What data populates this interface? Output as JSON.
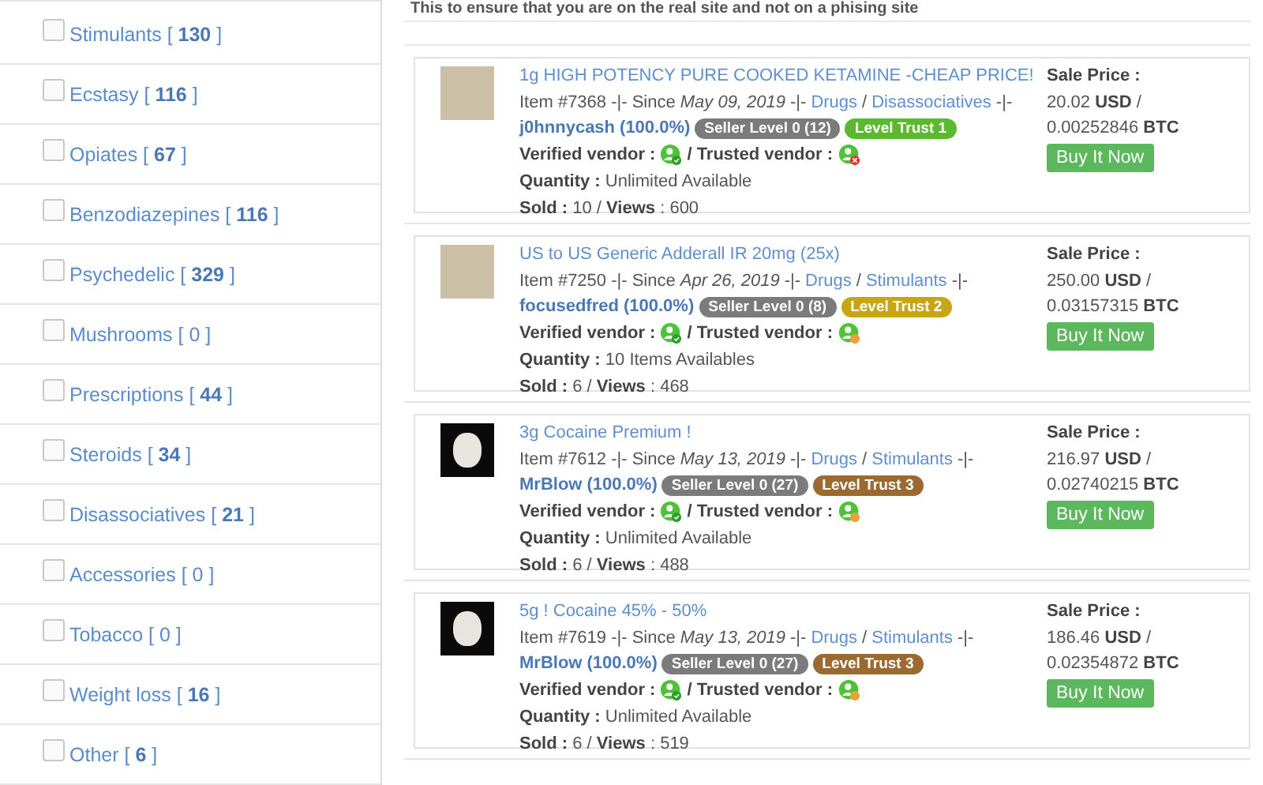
{
  "sidebar": {
    "categories": [
      {
        "label": "Stimulants [ **130** ]",
        "checked": false
      },
      {
        "label": "Ecstasy [ **116** ]",
        "checked": false
      },
      {
        "label": "Opiates [ **67** ]",
        "checked": false
      },
      {
        "label": "Benzodiazepines [ **116** ]",
        "checked": false
      },
      {
        "label": "Psychedelic [ **329** ]",
        "checked": false
      },
      {
        "label": "Mushrooms [ 0 ]",
        "checked": false
      },
      {
        "label": "Prescriptions [ **44** ]",
        "checked": false
      },
      {
        "label": "Steroids [ **34** ]",
        "checked": false
      },
      {
        "label": "Disassociatives [ **21** ]",
        "checked": false
      },
      {
        "label": "Accessories [ 0 ]",
        "checked": false
      },
      {
        "label": "Tobacco [ 0 ]",
        "checked": false
      },
      {
        "label": "Weight loss [ **16** ]",
        "checked": false
      },
      {
        "label": "Other [ **6** ]",
        "checked": false
      }
    ]
  },
  "notice": "This to ensure that you are on the real site and not on a phising site",
  "listings": [
    {
      "thumb": {
        "kind": "light"
      },
      "title": "1g HIGH POTENCY PURE COOKED KETAMINE -CHEAP PRICE!",
      "meta": [
        {
          "kind": "text",
          "text": "Item #7368 -|- Since"
        },
        {
          "kind": "date",
          "text": "May 09, 2019"
        },
        {
          "kind": "text",
          "text": "-|-"
        },
        {
          "kind": "link",
          "text": "Drugs"
        },
        {
          "kind": "text",
          "text": "/"
        },
        {
          "kind": "link",
          "text": "Disassociatives"
        },
        {
          "kind": "text",
          "text": "-|-"
        },
        {
          "kind": "seller",
          "text": "j0hnnycash"
        },
        {
          "kind": "seller",
          "text": "(100.0%)"
        },
        {
          "kind": "badge",
          "text": "Seller Level 0 (12)",
          "color": "#7b7b7b"
        },
        {
          "kind": "badge",
          "text": "Level Trust 1",
          "color": "#5cb82e"
        }
      ],
      "verified_label": "Verified vendor :",
      "verified": true,
      "trusted_label": "/ Trusted vendor :",
      "trusted": false,
      "quantity": "**Quantity :** Unlimited Available",
      "sold": "**Sold :** 10 / **Views** : 600",
      "price_label": "Sale Price :",
      "usd": "20.02 **USD** /",
      "btc": "0.00252846 **BTC**",
      "button": "Buy It Now"
    },
    {
      "thumb": {
        "kind": "light"
      },
      "title": "US to US Generic Adderall IR 20mg (25x)",
      "meta": [
        {
          "kind": "text",
          "text": "Item #7250 -|- Since"
        },
        {
          "kind": "date",
          "text": "Apr 26, 2019"
        },
        {
          "kind": "text",
          "text": "-|-"
        },
        {
          "kind": "link",
          "text": "Drugs"
        },
        {
          "kind": "text",
          "text": "/"
        },
        {
          "kind": "link",
          "text": "Stimulants"
        },
        {
          "kind": "text",
          "text": "-|-"
        },
        {
          "kind": "seller",
          "text": "focusedfred"
        },
        {
          "kind": "seller",
          "text": "(100.0%)"
        },
        {
          "kind": "badge",
          "text": "Seller Level 0 (8)",
          "color": "#7b7b7b"
        },
        {
          "kind": "badge",
          "text": "Level Trust 2",
          "color": "#c8a513"
        }
      ],
      "verified_label": "Verified vendor :",
      "verified": true,
      "trusted_label": "/ Trusted vendor :",
      "trusted": true,
      "quantity": "**Quantity :** 10 Items Availables",
      "sold": "**Sold :** 6 / **Views** : 468",
      "price_label": "Sale Price :",
      "usd": "250.00 **USD** /",
      "btc": "0.03157315 **BTC**",
      "button": "Buy It Now"
    },
    {
      "thumb": {
        "kind": "dark"
      },
      "title": "3g Cocaine Premium !",
      "meta": [
        {
          "kind": "text",
          "text": "Item #7612 -|- Since"
        },
        {
          "kind": "date",
          "text": "May 13, 2019"
        },
        {
          "kind": "text",
          "text": "-|-"
        },
        {
          "kind": "link",
          "text": "Drugs"
        },
        {
          "kind": "text",
          "text": "/"
        },
        {
          "kind": "link",
          "text": "Stimulants"
        },
        {
          "kind": "text",
          "text": "-|-"
        },
        {
          "kind": "seller",
          "text": "MrBlow"
        },
        {
          "kind": "seller",
          "text": "(100.0%)"
        },
        {
          "kind": "badge",
          "text": "Seller Level 0 (27)",
          "color": "#7b7b7b"
        },
        {
          "kind": "badge",
          "text": "Level Trust 3",
          "color": "#9b6a31"
        }
      ],
      "verified_label": "Verified vendor :",
      "verified": true,
      "trusted_label": "/ Trusted vendor :",
      "trusted": true,
      "quantity": "**Quantity :** Unlimited Available",
      "sold": "**Sold :** 6 / **Views** : 488",
      "price_label": "Sale Price :",
      "usd": "216.97 **USD** /",
      "btc": "0.02740215 **BTC**",
      "button": "Buy It Now"
    },
    {
      "thumb": {
        "kind": "dark"
      },
      "title": "5g ! Cocaine 45% - 50%",
      "meta": [
        {
          "kind": "text",
          "text": "Item #7619 -|- Since"
        },
        {
          "kind": "date",
          "text": "May 13, 2019"
        },
        {
          "kind": "text",
          "text": "-|-"
        },
        {
          "kind": "link",
          "text": "Drugs"
        },
        {
          "kind": "text",
          "text": "/"
        },
        {
          "kind": "link",
          "text": "Stimulants"
        },
        {
          "kind": "text",
          "text": "-|-"
        },
        {
          "kind": "seller",
          "text": "MrBlow"
        },
        {
          "kind": "seller",
          "text": "(100.0%)"
        },
        {
          "kind": "badge",
          "text": "Seller Level 0 (27)",
          "color": "#7b7b7b"
        },
        {
          "kind": "badge",
          "text": "Level Trust 3",
          "color": "#9b6a31"
        }
      ],
      "verified_label": "Verified vendor :",
      "verified": true,
      "trusted_label": "/ Trusted vendor :",
      "trusted": true,
      "quantity": "**Quantity :** Unlimited Available",
      "sold": "**Sold :** 6 / **Views** : 519",
      "price_label": "Sale Price :",
      "usd": "186.46 **USD** /",
      "btc": "0.02354872 **BTC**",
      "button": "Buy It Now"
    }
  ]
}
